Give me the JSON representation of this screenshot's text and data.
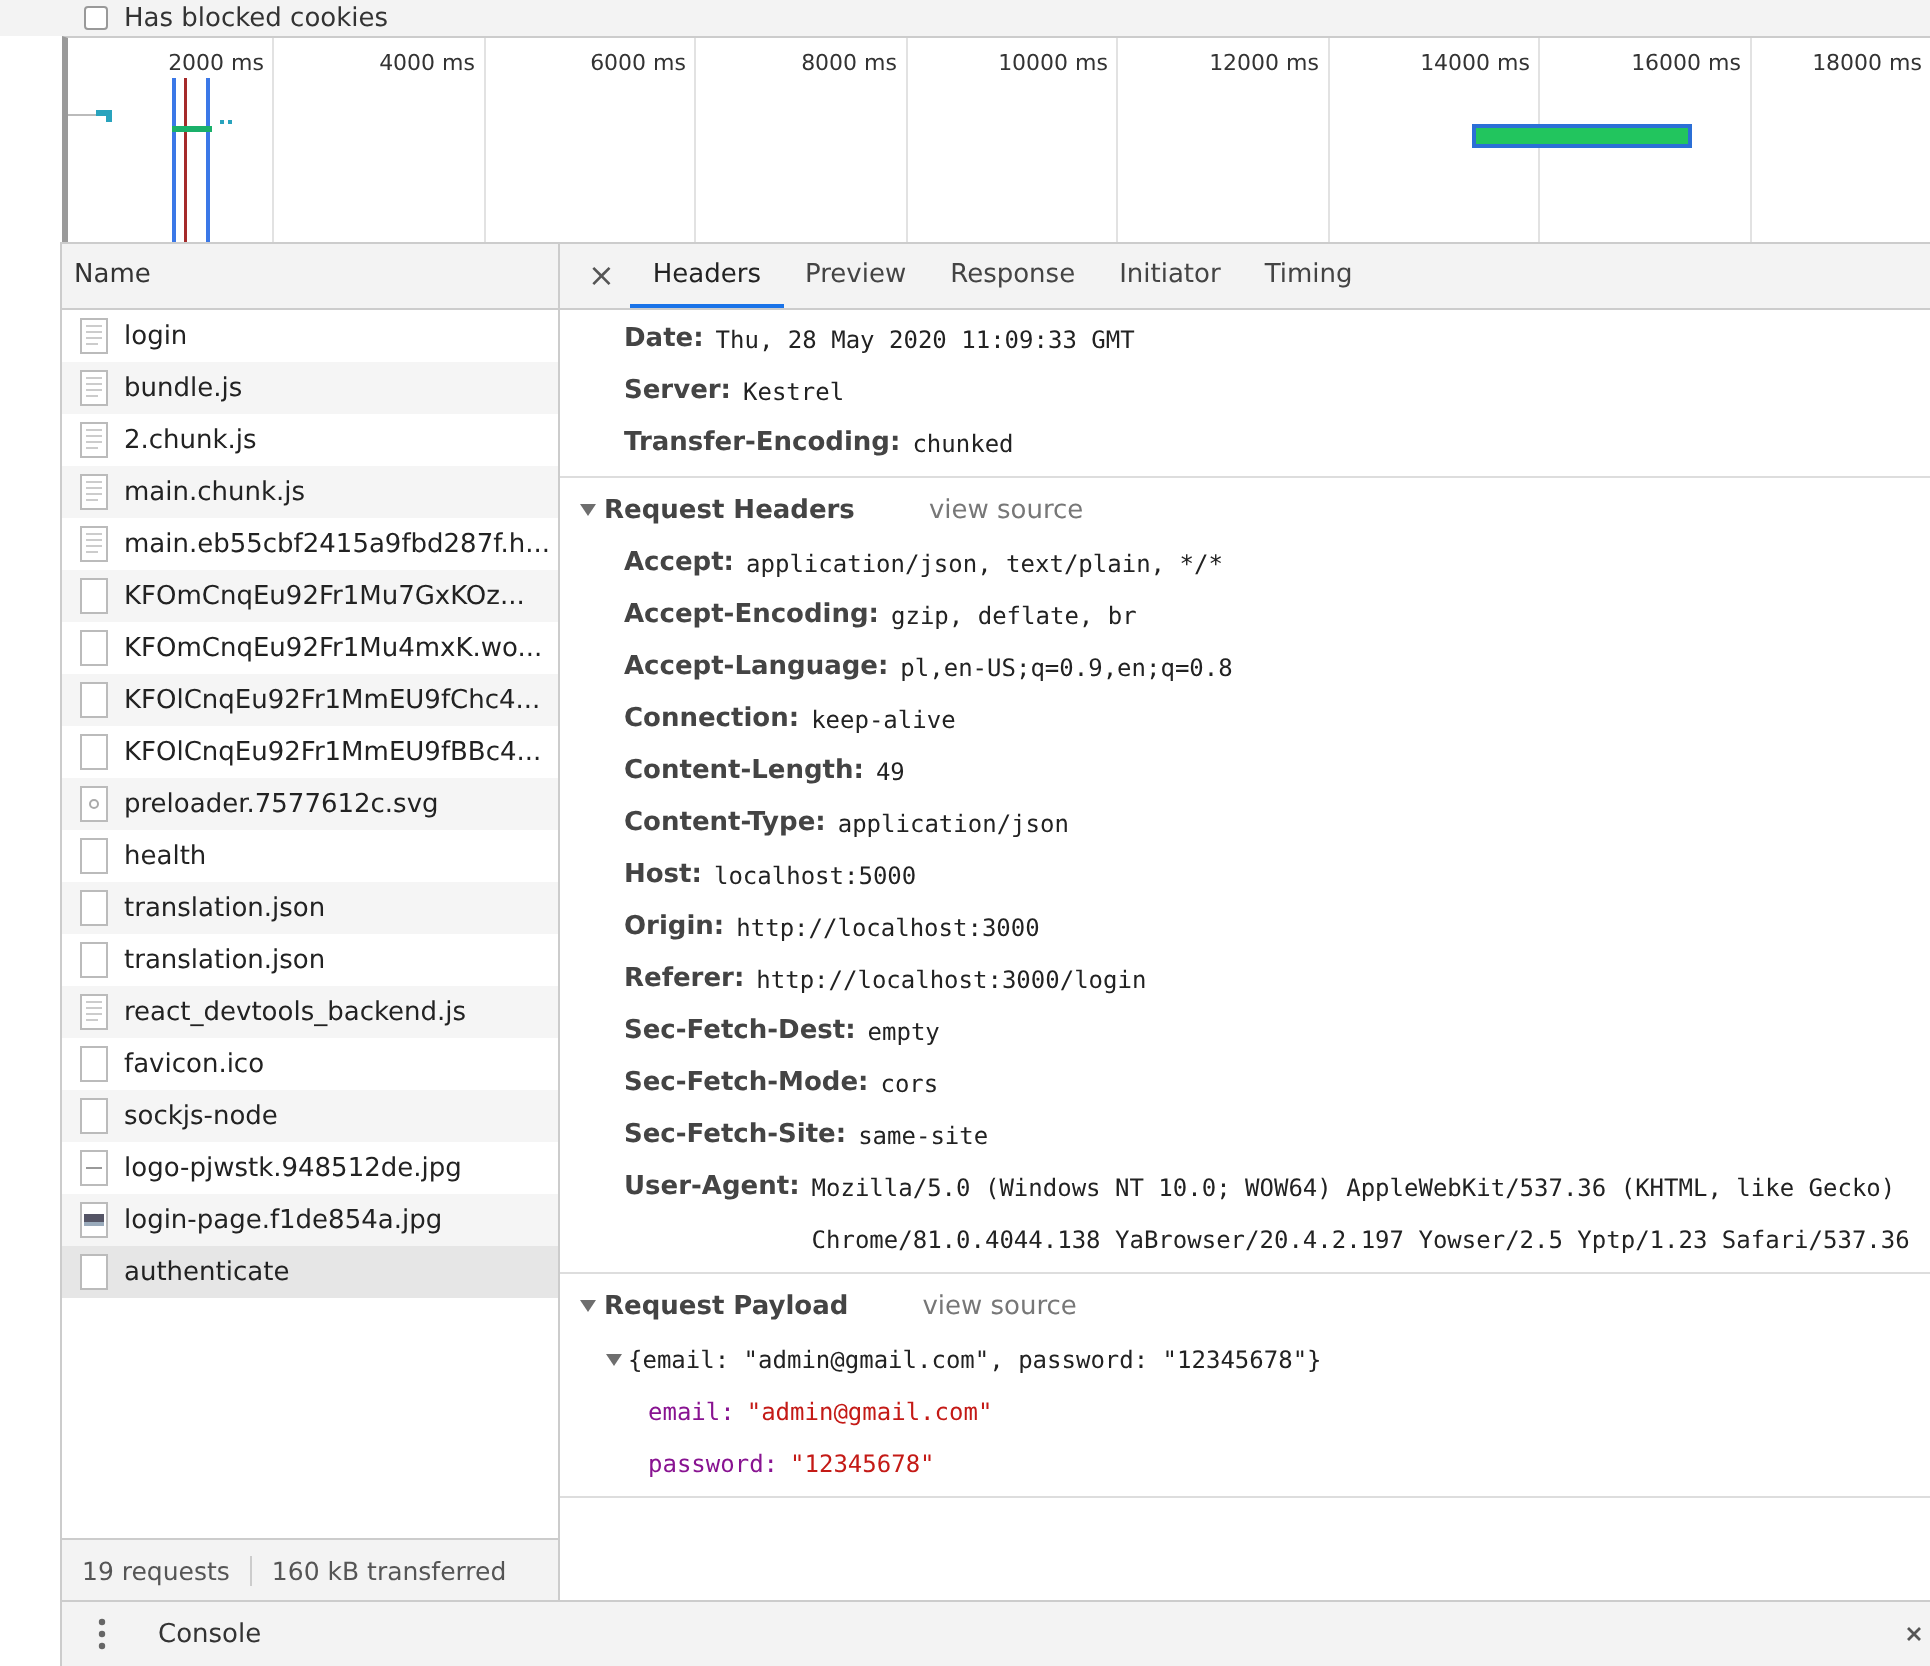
{
  "filter": {
    "label": "Has blocked cookies",
    "checked": false
  },
  "timeline": {
    "ticks": [
      "2000 ms",
      "4000 ms",
      "6000 ms",
      "8000 ms",
      "10000 ms",
      "12000 ms",
      "14000 ms",
      "16000 ms",
      "18000 ms"
    ]
  },
  "requests": {
    "column": "Name",
    "items": [
      {
        "name": "login",
        "kind": "document",
        "selected": false
      },
      {
        "name": "bundle.js",
        "kind": "document",
        "selected": false
      },
      {
        "name": "2.chunk.js",
        "kind": "document",
        "selected": false
      },
      {
        "name": "main.chunk.js",
        "kind": "document",
        "selected": false
      },
      {
        "name": "main.eb55cbf2415a9fbd287f.h...",
        "kind": "document",
        "selected": false
      },
      {
        "name": "KFOmCnqEu92Fr1Mu7GxKOz...",
        "kind": "blank",
        "selected": false
      },
      {
        "name": "KFOmCnqEu92Fr1Mu4mxK.wo...",
        "kind": "blank",
        "selected": false
      },
      {
        "name": "KFOlCnqEu92Fr1MmEU9fChc4...",
        "kind": "blank",
        "selected": false
      },
      {
        "name": "KFOlCnqEu92Fr1MmEU9fBBc4...",
        "kind": "blank",
        "selected": false
      },
      {
        "name": "preloader.7577612c.svg",
        "kind": "svg",
        "selected": false
      },
      {
        "name": "health",
        "kind": "blank",
        "selected": false
      },
      {
        "name": "translation.json",
        "kind": "blank",
        "selected": false
      },
      {
        "name": "translation.json",
        "kind": "blank",
        "selected": false
      },
      {
        "name": "react_devtools_backend.js",
        "kind": "document",
        "selected": false
      },
      {
        "name": "favicon.ico",
        "kind": "blank",
        "selected": false
      },
      {
        "name": "sockjs-node",
        "kind": "blank",
        "selected": false
      },
      {
        "name": "logo-pjwstk.948512de.jpg",
        "kind": "image",
        "selected": false
      },
      {
        "name": "login-page.f1de854a.jpg",
        "kind": "photo",
        "selected": false
      },
      {
        "name": "authenticate",
        "kind": "blank",
        "selected": true
      }
    ],
    "summary": [
      "19 requests",
      "160 kB transferred"
    ]
  },
  "details": {
    "close": "×",
    "tabs": [
      {
        "label": "Headers",
        "selected": true
      },
      {
        "label": "Preview",
        "selected": false
      },
      {
        "label": "Response",
        "selected": false
      },
      {
        "label": "Initiator",
        "selected": false
      },
      {
        "label": "Timing",
        "selected": false
      }
    ],
    "response_headers": {
      "headers": [
        {
          "name": "Date:",
          "value": "Thu, 28 May 2020 11:09:33 GMT"
        },
        {
          "name": "Server:",
          "value": "Kestrel"
        },
        {
          "name": "Transfer-Encoding:",
          "value": "chunked"
        }
      ]
    },
    "request_headers": {
      "title": "Request Headers",
      "link": "view source",
      "expanded": true,
      "headers": [
        {
          "name": "Accept:",
          "value": "application/json, text/plain, */*"
        },
        {
          "name": "Accept-Encoding:",
          "value": "gzip, deflate, br"
        },
        {
          "name": "Accept-Language:",
          "value": "pl,en-US;q=0.9,en;q=0.8"
        },
        {
          "name": "Connection:",
          "value": "keep-alive"
        },
        {
          "name": "Content-Length:",
          "value": "49"
        },
        {
          "name": "Content-Type:",
          "value": "application/json"
        },
        {
          "name": "Host:",
          "value": "localhost:5000"
        },
        {
          "name": "Origin:",
          "value": "http://localhost:3000"
        },
        {
          "name": "Referer:",
          "value": "http://localhost:3000/login"
        },
        {
          "name": "Sec-Fetch-Dest:",
          "value": "empty"
        },
        {
          "name": "Sec-Fetch-Mode:",
          "value": "cors"
        },
        {
          "name": "Sec-Fetch-Site:",
          "value": "same-site"
        },
        {
          "name": "User-Agent:",
          "value": "Mozilla/5.0 (Windows NT 10.0; WOW64) AppleWebKit/537.36 (KHTML, like Gecko) Chrome/81.0.4044.138 YaBrowser/20.4.2.197 Yowser/2.5 Yptp/1.23 Safari/537.36"
        }
      ]
    },
    "request_payload": {
      "title": "Request Payload",
      "link": "view source",
      "expanded": true,
      "summary": "{email: \"admin@gmail.com\", password: \"12345678\"}",
      "tree_expanded": true,
      "properties": [
        {
          "key": "email:",
          "value": "\"admin@gmail.com\""
        },
        {
          "key": "password:",
          "value": "\"12345678\""
        }
      ]
    }
  },
  "drawer": {
    "tab": "Console"
  }
}
